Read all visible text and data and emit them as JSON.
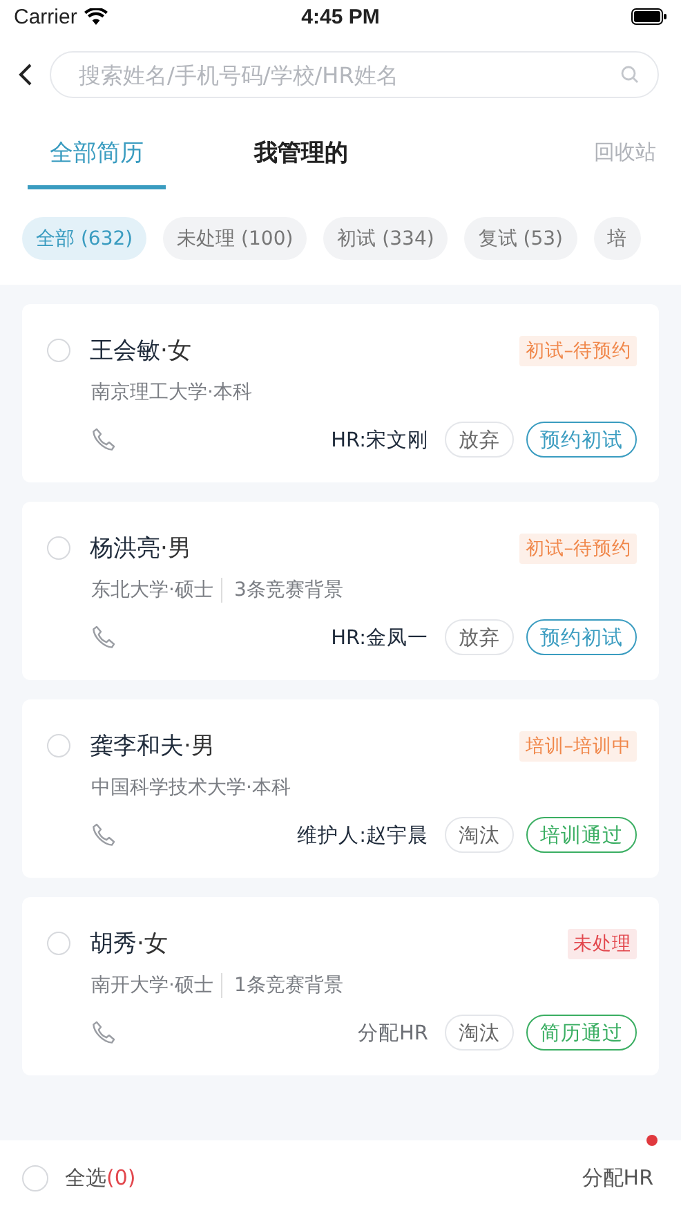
{
  "status_bar": {
    "carrier": "Carrier",
    "time": "4:45 PM"
  },
  "search": {
    "placeholder": "搜索姓名/手机号码/学校/HR姓名"
  },
  "tabs": [
    {
      "label": "全部简历",
      "selected": true
    },
    {
      "label": "我管理的",
      "selected": false
    }
  ],
  "recycle_bin": "回收站",
  "filters": [
    {
      "label": "全部 (632)",
      "selected": true
    },
    {
      "label": "未处理 (100)",
      "selected": false
    },
    {
      "label": "初试 (334)",
      "selected": false
    },
    {
      "label": "复试 (53)",
      "selected": false
    },
    {
      "label": "培",
      "selected": false
    }
  ],
  "candidates": [
    {
      "name": "**王会敏**·女",
      "selected": false,
      "school": "南京理工大学·本科",
      "status": {
        "label": "初试–待预约",
        "color": "#f0874a"
      },
      "owner": {
        "kind": "assigned",
        "label": "HR:宋文刚"
      },
      "reject": "放弃",
      "action": {
        "label": "预约初试",
        "color": "#3a9cc0"
      }
    },
    {
      "name": "**杨洪亮**·男",
      "selected": false,
      "school": "东北大学·硕士",
      "background": "3条竞赛背景",
      "status": {
        "label": "初试–待预约",
        "color": "#f0874a"
      },
      "owner": {
        "kind": "assigned",
        "label": "HR:金凤一"
      },
      "reject": "放弃",
      "action": {
        "label": "预约初试",
        "color": "#3a9cc0"
      }
    },
    {
      "name": "**龚李和夫**·男",
      "selected": false,
      "school": "中国科学技术大学·本科",
      "status": {
        "label": "培训–培训中",
        "color": "#f0874a"
      },
      "owner": {
        "kind": "assigned",
        "label": "维护人:赵宇晨"
      },
      "reject": "淘汰",
      "action": {
        "label": "培训通过",
        "color": "#3aae62"
      }
    },
    {
      "name": "**胡秀**·女",
      "selected": false,
      "school": "南开大学·硕士",
      "background": "1条竞赛背景",
      "status": {
        "label": "未处理",
        "color": "#e2474d"
      },
      "owner": {
        "kind": "unassigned",
        "label": "分配HR"
      },
      "reject": "淘汰",
      "action": {
        "label": "简历通过",
        "color": "#3aae62"
      }
    }
  ],
  "bottom_bar": {
    "select_all": {
      "label": "全选",
      "count": "(0)",
      "checked": false
    },
    "assign_button": "分配HR",
    "has_notification": true
  }
}
